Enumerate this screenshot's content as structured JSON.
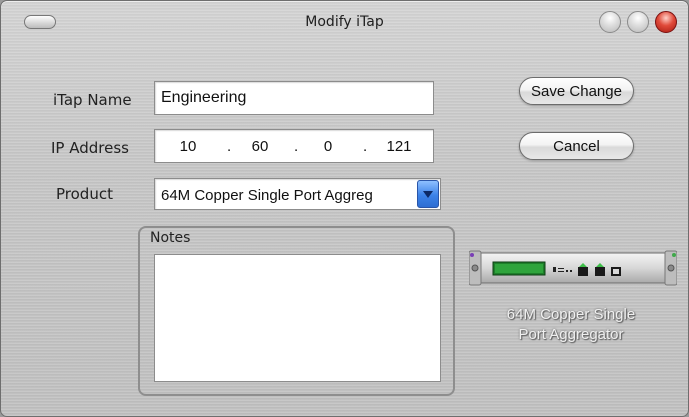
{
  "window": {
    "title": "Modify iTap"
  },
  "form": {
    "itap_name_label": "iTap Name",
    "itap_name_value": "Engineering",
    "ip_label": "IP Address",
    "ip_octets": [
      "10",
      "60",
      "0",
      "121"
    ],
    "ip_separator": ".",
    "product_label": "Product",
    "product_value": "64M Copper Single Port Aggreg",
    "notes_label": "Notes",
    "notes_value": ""
  },
  "buttons": {
    "save_label": "Save Change",
    "cancel_label": "Cancel"
  },
  "device": {
    "caption_line1": "64M Copper Single",
    "caption_line2": "Port Aggregator"
  },
  "icons": {
    "titlebar_left": "pill-button-icon",
    "window_controls": [
      "minimize-icon",
      "zoom-icon",
      "close-icon"
    ],
    "product_dropdown": "chevron-down-icon",
    "device_image": "network-tap-device-icon"
  },
  "colors": {
    "close_button": "#e04a3a",
    "dropdown_arrow": "#3c82e8",
    "device_lcd": "#1e7f2a"
  }
}
